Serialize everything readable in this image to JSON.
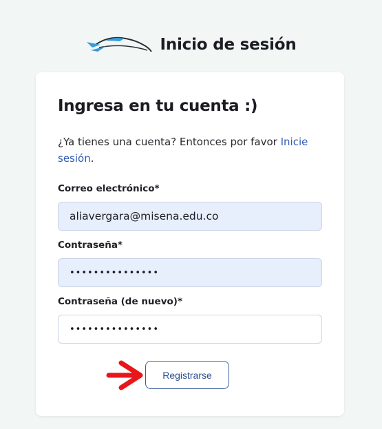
{
  "header": {
    "title": "Inicio de sesión",
    "logo_icon": "car-logo-icon"
  },
  "card": {
    "title": "Ingresa en tu cuenta :)",
    "intro_text": "¿Ya tienes una cuenta? Entonces por favor ",
    "intro_link": "Inicie sesión",
    "intro_end": "."
  },
  "form": {
    "email_label": "Correo electrónico*",
    "email_value": "aliavergara@misena.edu.co",
    "password_label": "Contraseña*",
    "password_value": "•••••••••••••••",
    "password2_label": "Contraseña (de nuevo)*",
    "password2_value": "•••••••••••••••",
    "submit_label": "Registrarse"
  },
  "colors": {
    "accent": "#2f5bb5",
    "arrow": "#e8161b",
    "field_fill": "#e7eefc"
  }
}
